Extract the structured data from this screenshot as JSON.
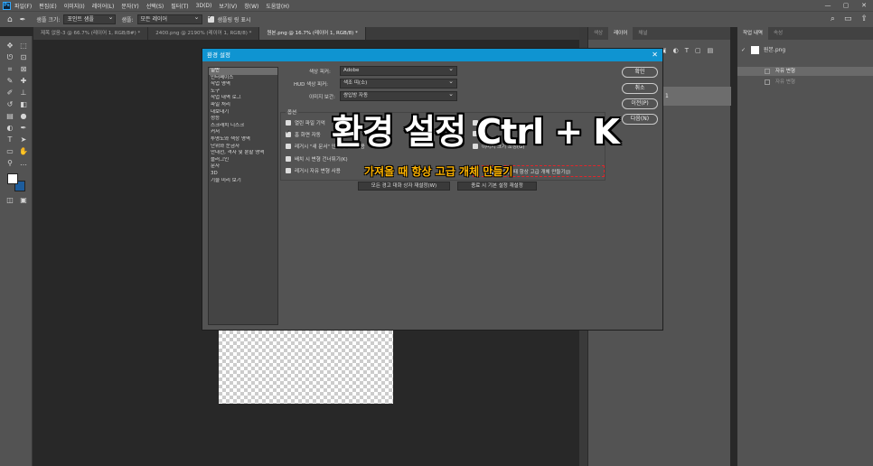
{
  "menu": {
    "items": [
      "파일(F)",
      "편집(E)",
      "이미지(I)",
      "레이어(L)",
      "문자(Y)",
      "선택(S)",
      "필터(T)",
      "3D(D)",
      "보기(V)",
      "창(W)",
      "도움말(H)"
    ]
  },
  "options_bar": {
    "sample_size_label": "샘플 크기:",
    "sample_size_value": "포인트 샘플",
    "sample_label": "샘플:",
    "sample_value": "모든 레이어",
    "show_ring_label": "샘플링 링 표시"
  },
  "doc_tabs": [
    "제목 없음-3 @ 66.7% (레이어 1, RGB/8#) *",
    "2400.png @ 2190% (레이어 1, RGB/8) *",
    "원본.png @ 16.7% (레이어 1, RGB/8) *"
  ],
  "panel_a": {
    "tabs": [
      "색상",
      "레이어",
      "채널"
    ],
    "layer_name": "이어 1"
  },
  "panel_b": {
    "tabs": [
      "작업 내역",
      "속성"
    ],
    "snapshot": "원본.png",
    "history": [
      "자유 변형",
      "자유 변형"
    ]
  },
  "dialog": {
    "title": "환경 설정",
    "close": "✕",
    "categories": [
      "일반",
      "인터페이스",
      "작업 영역",
      "도구",
      "작업 내역 로그",
      "파일 처리",
      "내보내기",
      "성능",
      "스크래치 디스크",
      "커서",
      "투명도와 색상 영역",
      "단위와 눈금자",
      "안내선, 격자 및 분할 영역",
      "플러그인",
      "문자",
      "3D",
      "기술 미리 보기"
    ],
    "color_picker_label": "색상 피커:",
    "color_picker_value": "Adobe",
    "hud_label": "HUD 색상 피커:",
    "hud_value": "색조 띠(소)",
    "interp_label": "이미지 보간:",
    "interp_value": "쌍입방 자동",
    "options_legend": "옵션",
    "options": [
      {
        "label": "열린 파일 기억",
        "checked": false
      },
      {
        "label": "홈 화면 자동",
        "checked": true
      },
      {
        "label": "레거시 \"새 문서\" 인터페이스 사용",
        "checked": false
      },
      {
        "label": "배치 시 변형 건너뛰기(K)",
        "checked": false
      },
      {
        "label": "레거시 자유 변형 사용",
        "checked": false
      }
    ],
    "options_right": [
      {
        "label": "알",
        "checked": false
      },
      {
        "label": "X",
        "checked": false
      },
      {
        "label": "이미지 크기 조정(G)",
        "checked": false
      },
      {
        "label": "가져올 때 항상 고급 개체 만들기(J)",
        "checked": true
      }
    ],
    "reset_warnings": "모든 경고 대화 상자 재설정(W)",
    "reset_prefs": "종료 시 기본 설정 재설정",
    "buttons": [
      "확인",
      "취소",
      "이전(P)",
      "다음(N)"
    ]
  },
  "overlay": {
    "title": "환경 설정 Ctrl + K",
    "subtitle": "가져올 때 항상 고급 개체 만들기"
  },
  "colors": {
    "title_bar": "#0f94d1",
    "highlight_box": "#e0272c",
    "subtitle": "#ffb400"
  }
}
